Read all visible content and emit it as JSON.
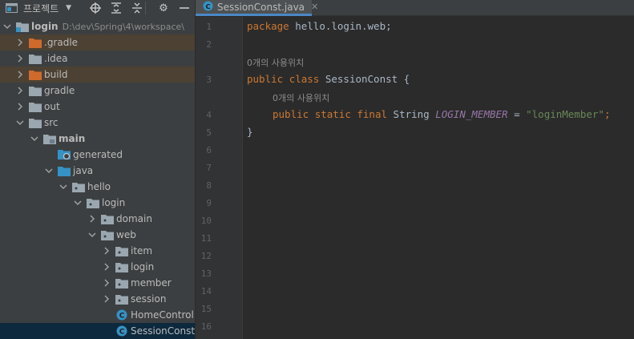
{
  "project_panel": {
    "title": "프로젝트",
    "tree": [
      {
        "label": "login",
        "path": "D:\\dev\\Spring\\4\\workspace\\",
        "bold": true,
        "icon": "module-folder-icon",
        "expanded": true,
        "excluded": false
      },
      {
        "label": ".gradle",
        "icon": "folder-excluded-icon",
        "expanded": false,
        "excluded": true
      },
      {
        "label": ".idea",
        "icon": "folder-icon",
        "expanded": false,
        "excluded": false
      },
      {
        "label": "build",
        "icon": "folder-excluded-icon",
        "expanded": false,
        "excluded": true
      },
      {
        "label": "gradle",
        "icon": "folder-icon",
        "expanded": false,
        "excluded": false
      },
      {
        "label": "out",
        "icon": "folder-icon",
        "expanded": false,
        "excluded": false
      },
      {
        "label": "src",
        "icon": "folder-icon",
        "expanded": true,
        "excluded": false
      },
      {
        "label": "main",
        "icon": "folder-icon",
        "bold": true,
        "expanded": true,
        "excluded": false
      },
      {
        "label": "generated",
        "icon": "generated-folder-icon",
        "expanded": null,
        "excluded": false
      },
      {
        "label": "java",
        "icon": "source-folder-icon",
        "expanded": true,
        "excluded": false
      },
      {
        "label": "hello",
        "icon": "package-icon",
        "expanded": true,
        "excluded": false
      },
      {
        "label": "login",
        "icon": "package-icon",
        "expanded": true,
        "excluded": false
      },
      {
        "label": "domain",
        "icon": "package-icon",
        "expanded": false,
        "excluded": false
      },
      {
        "label": "web",
        "icon": "package-icon",
        "expanded": true,
        "excluded": false
      },
      {
        "label": "item",
        "icon": "package-icon",
        "expanded": false,
        "excluded": false
      },
      {
        "label": "login",
        "icon": "package-icon",
        "expanded": false,
        "excluded": false
      },
      {
        "label": "member",
        "icon": "package-icon",
        "expanded": false,
        "excluded": false
      },
      {
        "label": "session",
        "icon": "package-icon",
        "expanded": false,
        "excluded": false
      },
      {
        "label": "HomeController",
        "icon": "java-class-icon",
        "expanded": null,
        "excluded": false
      },
      {
        "label": "SessionConst",
        "icon": "java-class-icon",
        "expanded": null,
        "excluded": false,
        "selected": true
      }
    ]
  },
  "editor": {
    "tab": {
      "label": "SessionConst.java",
      "icon": "java-class-icon"
    },
    "line_numbers": [
      "1",
      "2",
      "3",
      "4",
      "5",
      "6",
      "7",
      "8",
      "9",
      "10",
      "11",
      "12",
      "13",
      "14",
      "15",
      "16"
    ],
    "inlay_usages": "0개의 사용위치",
    "code": {
      "line1": {
        "kw": "package",
        "rest": " hello.login.web;"
      },
      "line3": {
        "kw1": "public",
        "kw2": "class",
        "name": " SessionConst {"
      },
      "line4": {
        "kw1": "public",
        "kw2": "static",
        "kw3": "final",
        "type": " String ",
        "field": "LOGIN_MEMBER",
        "op": " = ",
        "value": "\"loginMember\"",
        "end": ";"
      },
      "line5": "}"
    }
  },
  "colors": {
    "panel_bg": "#3c3f41",
    "editor_bg": "#2b2b2b",
    "keyword": "#cc7832",
    "string": "#6a8759",
    "field": "#9876aa",
    "excluded_row": "#4c4133",
    "selected_row": "#0d293e",
    "java_class_icon": "#3592c4"
  }
}
